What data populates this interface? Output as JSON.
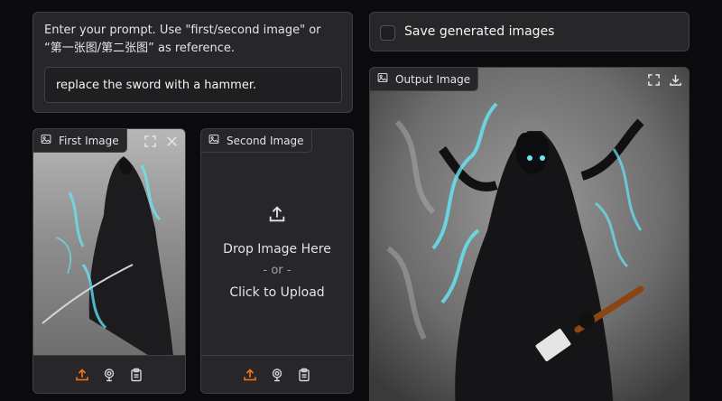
{
  "prompt": {
    "label": "Enter your prompt. Use \"first/second image\" or “第一张图/第二张图” as reference.",
    "value": "replace the sword with a hammer."
  },
  "save": {
    "label": "Save generated images",
    "checked": false
  },
  "first_image": {
    "label": "First Image"
  },
  "second_image": {
    "label": "Second Image",
    "drop_text": "Drop Image Here",
    "or_text": "- or -",
    "upload_text": "Click to Upload"
  },
  "output_image": {
    "label": "Output Image"
  },
  "icons": {
    "image": "image-icon",
    "fullscreen": "fullscreen-icon",
    "close": "close-icon",
    "download": "download-icon",
    "upload": "upload-icon",
    "webcam": "webcam-icon",
    "clipboard": "clipboard-icon"
  },
  "colors": {
    "background": "#0b0b0d",
    "panel": "#27272a",
    "border": "#3f3f46",
    "accent": "#f97316",
    "glow": "#67e8f9"
  }
}
